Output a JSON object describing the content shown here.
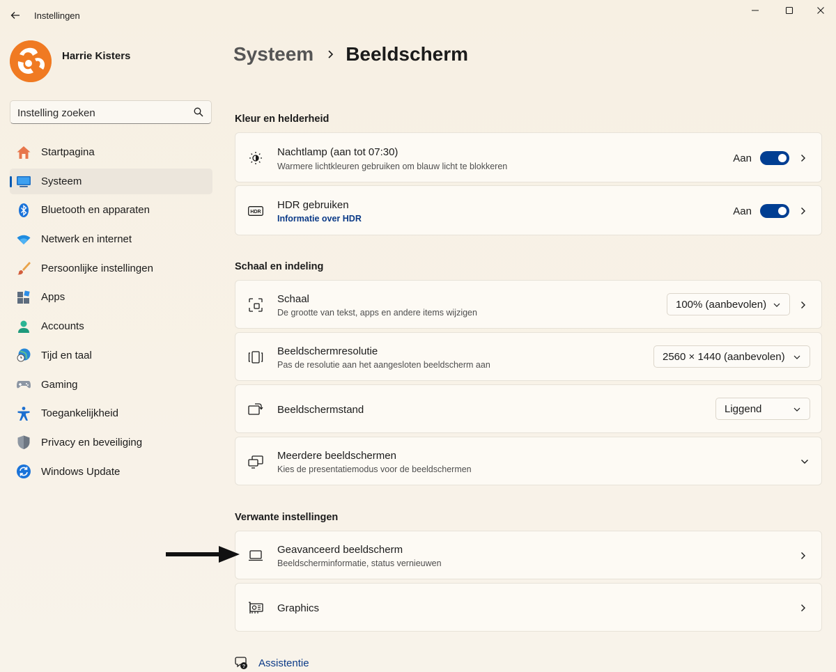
{
  "window": {
    "title": "Instellingen",
    "controls": [
      "minimize-icon",
      "maximize-icon",
      "close-icon"
    ]
  },
  "profile": {
    "name": "Harrie Kisters"
  },
  "search": {
    "placeholder": "Instelling zoeken"
  },
  "sidebar": {
    "items": [
      {
        "label": "Startpagina",
        "icon": "home-icon",
        "active": false
      },
      {
        "label": "Systeem",
        "icon": "system-icon",
        "active": true
      },
      {
        "label": "Bluetooth en apparaten",
        "icon": "bluetooth-icon",
        "active": false
      },
      {
        "label": "Netwerk en internet",
        "icon": "wifi-icon",
        "active": false
      },
      {
        "label": "Persoonlijke instellingen",
        "icon": "brush-icon",
        "active": false
      },
      {
        "label": "Apps",
        "icon": "apps-icon",
        "active": false
      },
      {
        "label": "Accounts",
        "icon": "accounts-icon",
        "active": false
      },
      {
        "label": "Tijd en taal",
        "icon": "time-language-icon",
        "active": false
      },
      {
        "label": "Gaming",
        "icon": "gamepad-icon",
        "active": false
      },
      {
        "label": "Toegankelijkheid",
        "icon": "accessibility-icon",
        "active": false
      },
      {
        "label": "Privacy en beveiliging",
        "icon": "shield-icon",
        "active": false
      },
      {
        "label": "Windows Update",
        "icon": "update-icon",
        "active": false
      }
    ]
  },
  "breadcrumb": {
    "parent": "Systeem",
    "current": "Beeldscherm"
  },
  "sections": {
    "color": {
      "title": "Kleur en helderheid",
      "nightlight": {
        "title": "Nachtlamp (aan tot 07:30)",
        "subtitle": "Warmere lichtkleuren gebruiken om blauw licht te blokkeren",
        "state": "Aan",
        "on": true
      },
      "hdr": {
        "title": "HDR gebruiken",
        "link": "Informatie over HDR",
        "state": "Aan",
        "on": true
      }
    },
    "scale": {
      "title": "Schaal en indeling",
      "scale": {
        "title": "Schaal",
        "subtitle": "De grootte van tekst, apps en andere items wijzigen",
        "value": "100% (aanbevolen)"
      },
      "resolution": {
        "title": "Beeldschermresolutie",
        "subtitle": "Pas de resolutie aan het aangesloten beeldscherm aan",
        "value": "2560 × 1440 (aanbevolen)"
      },
      "orientation": {
        "title": "Beeldschermstand",
        "value": "Liggend"
      },
      "multi": {
        "title": "Meerdere beeldschermen",
        "subtitle": "Kies de presentatiemodus voor de beeldschermen"
      }
    },
    "related": {
      "title": "Verwante instellingen",
      "advanced": {
        "title": "Geavanceerd beeldscherm",
        "subtitle": "Beeldscherminformatie, status vernieuwen"
      },
      "graphics": {
        "title": "Graphics"
      }
    }
  },
  "help": {
    "label": "Assistentie"
  },
  "colors": {
    "accent": "#003e92",
    "avatar": "#f07a22",
    "link": "#0b3a87"
  }
}
